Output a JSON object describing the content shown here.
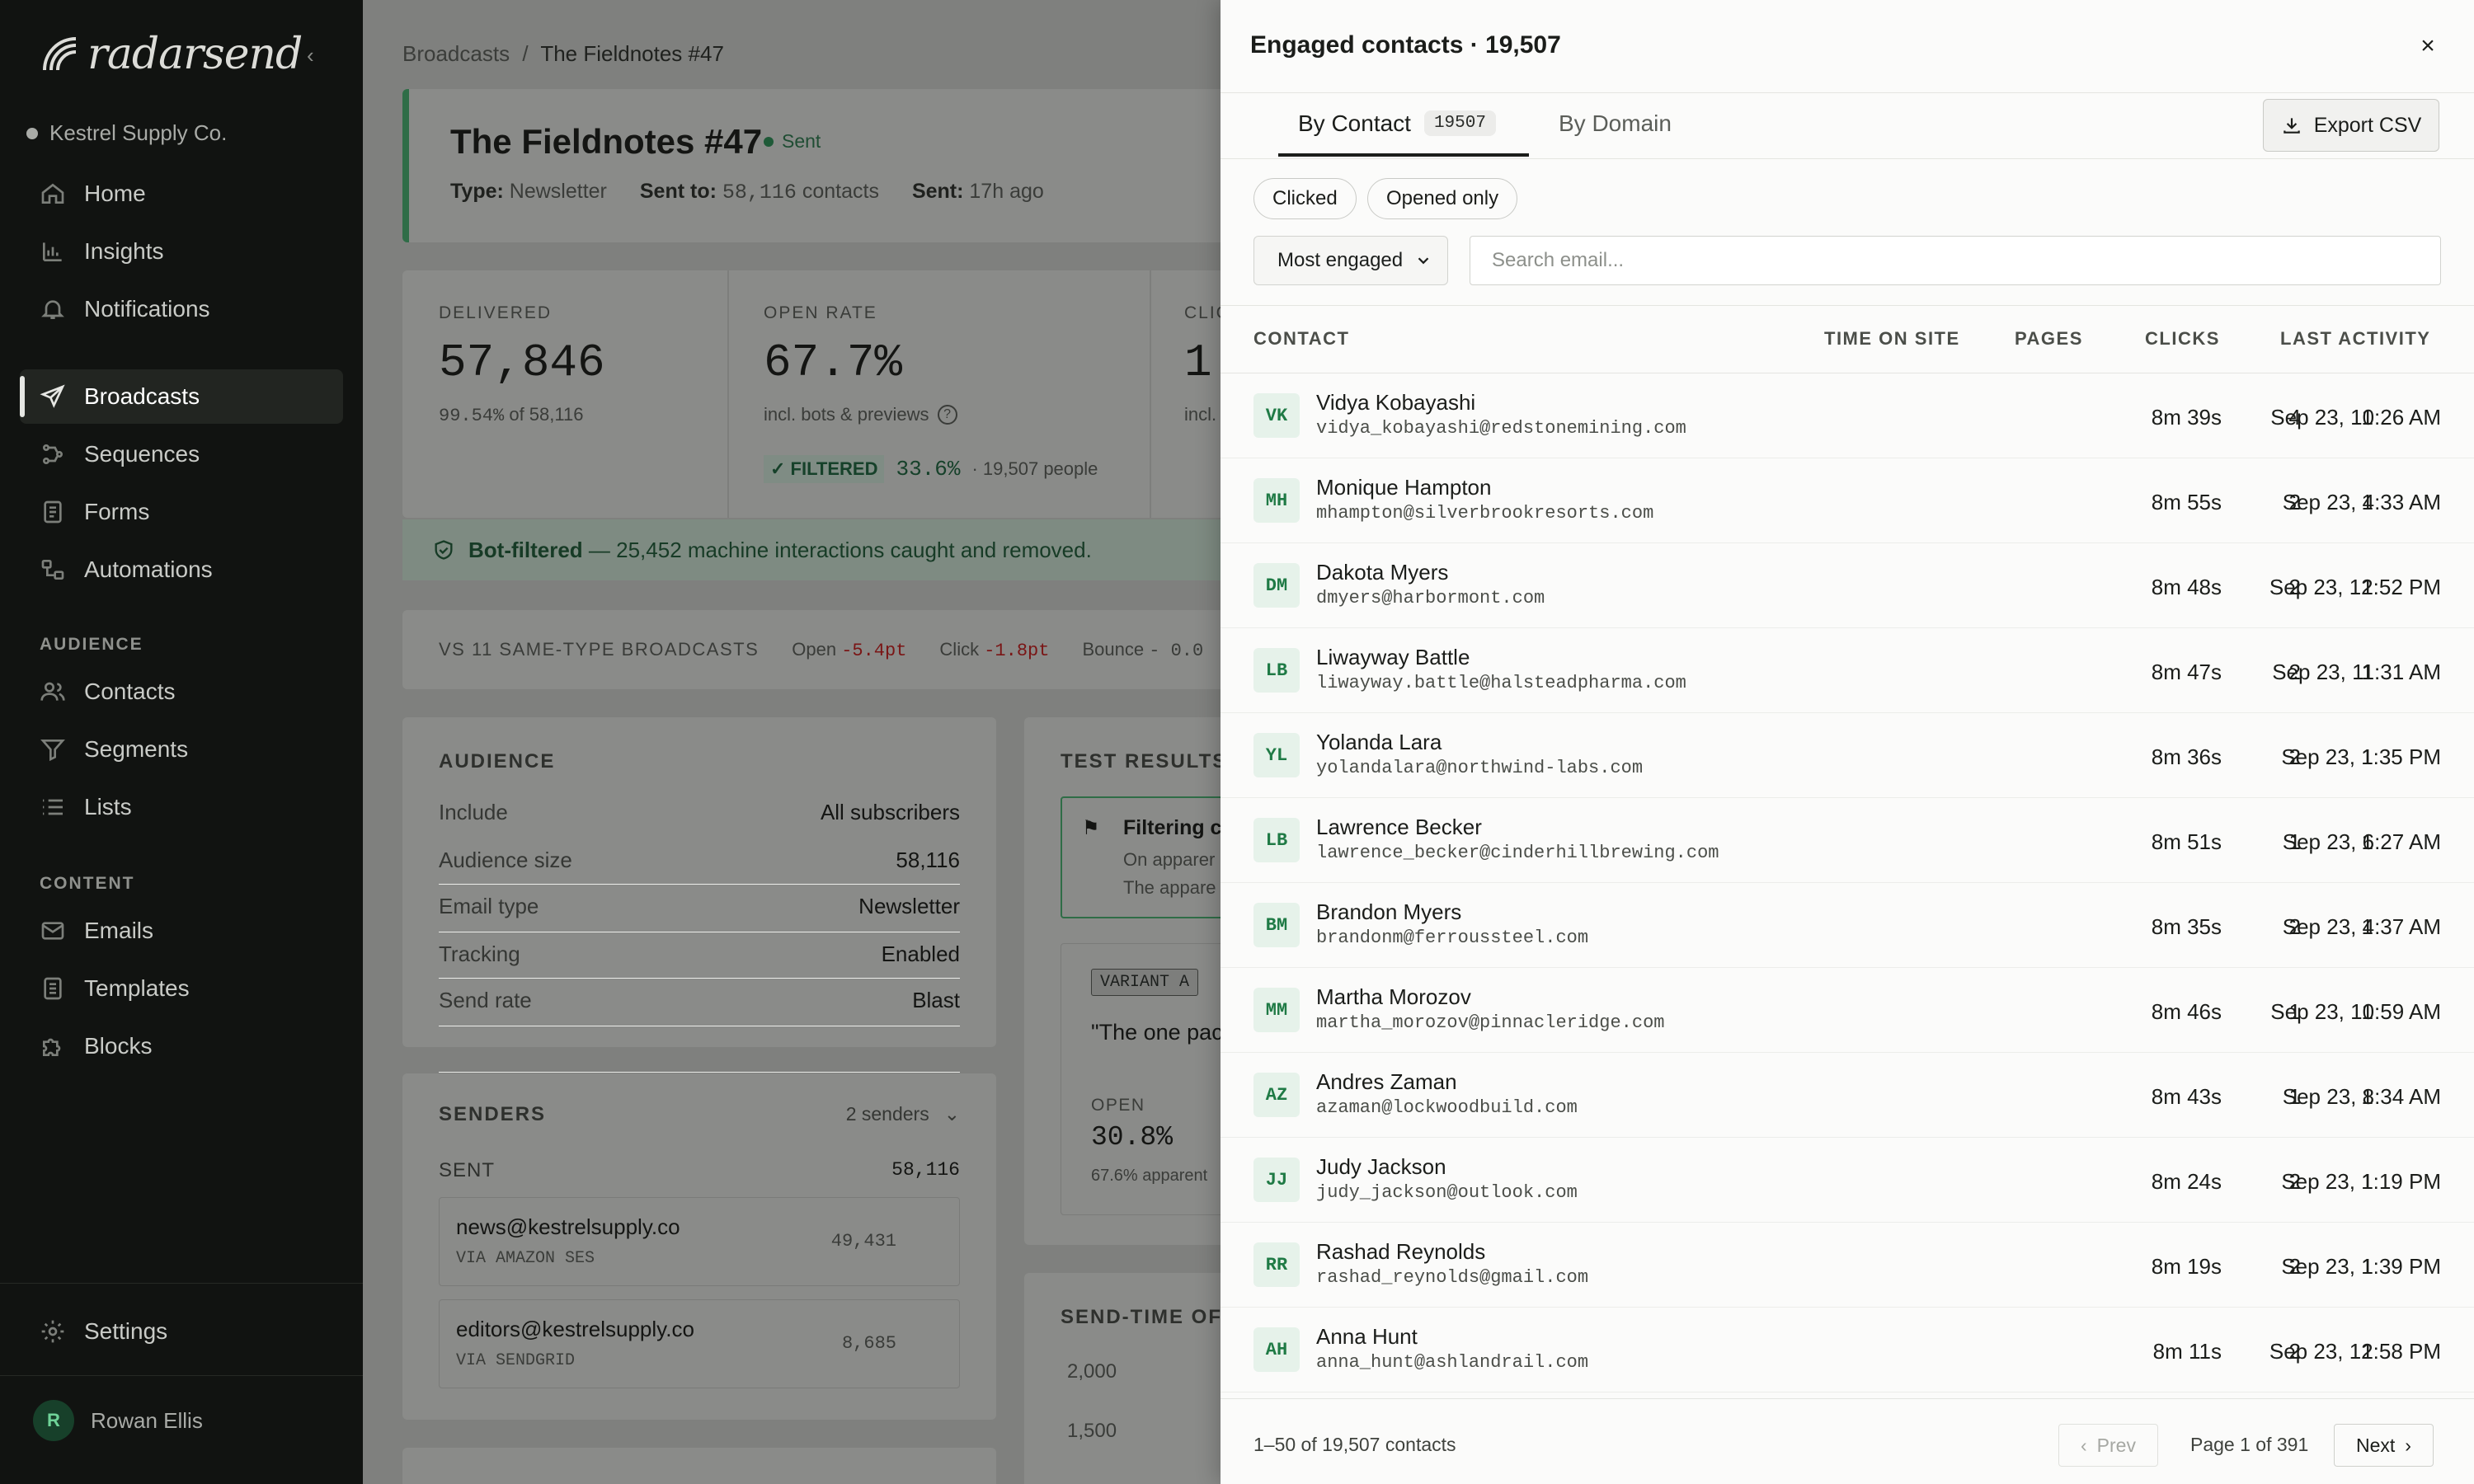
{
  "sidebar": {
    "brand": "radarsend",
    "org": "Kestrel Supply Co.",
    "nav": [
      {
        "label": "Home",
        "icon": "home-icon"
      },
      {
        "label": "Insights",
        "icon": "chart-icon"
      },
      {
        "label": "Notifications",
        "icon": "bell-icon"
      },
      {
        "label": "Broadcasts",
        "icon": "send-icon"
      },
      {
        "label": "Sequences",
        "icon": "sequence-icon"
      },
      {
        "label": "Forms",
        "icon": "form-icon"
      },
      {
        "label": "Automations",
        "icon": "automation-icon"
      }
    ],
    "audience_label": "AUDIENCE",
    "audience": [
      {
        "label": "Contacts",
        "icon": "users-icon"
      },
      {
        "label": "Segments",
        "icon": "filter-icon"
      },
      {
        "label": "Lists",
        "icon": "list-icon"
      }
    ],
    "content_label": "CONTENT",
    "content": [
      {
        "label": "Emails",
        "icon": "mail-icon"
      },
      {
        "label": "Templates",
        "icon": "template-icon"
      },
      {
        "label": "Blocks",
        "icon": "puzzle-icon"
      }
    ],
    "settings": "Settings",
    "user_initial": "R",
    "user_name": "Rowan Ellis"
  },
  "main": {
    "breadcrumb_root": "Broadcasts",
    "breadcrumb_sep": "/",
    "breadcrumb_current": "The Fieldnotes #47",
    "title": "The Fieldnotes #47",
    "status": "Sent",
    "type_label": "Type:",
    "type_value": "Newsletter",
    "sent_to_label": "Sent to:",
    "sent_to_value": "58,116",
    "sent_to_unit": "contacts",
    "sent_label": "Sent:",
    "sent_value": "17h ago",
    "delivered_label": "DELIVERED",
    "delivered_value": "57,846",
    "delivered_pct": "99.54%",
    "delivered_of": "of 58,116",
    "open_label": "OPEN RATE",
    "open_value": "67.7%",
    "open_note": "incl. bots & previews",
    "filtered_badge": "✓ FILTERED",
    "filtered_value": "33.6%",
    "filtered_people": "· 19,507 people",
    "click_label": "CLIC",
    "click_value": "1:",
    "click_note": "incl.",
    "bot_title": "Bot-filtered",
    "bot_text": "— 25,452 machine interactions caught and removed.",
    "vs_label": "VS 11 SAME-TYPE BROADCASTS",
    "vs_open_label": "Open",
    "vs_open": "-5.4pt",
    "vs_click_label": "Click",
    "vs_click": "-1.8pt",
    "vs_bounce_label": "Bounce",
    "vs_bounce": "- 0.0",
    "audience_title": "AUDIENCE",
    "audience_rows": [
      {
        "k": "Include",
        "v": "All subscribers"
      },
      {
        "k": "Audience size",
        "v": "58,116"
      },
      {
        "k": "Email type",
        "v": "Newsletter"
      },
      {
        "k": "Tracking",
        "v": "Enabled"
      },
      {
        "k": "Send rate",
        "v": "Blast"
      }
    ],
    "senders_title": "SENDERS",
    "senders_count": "2 senders",
    "sent_title": "SENT",
    "sent_total": "58,116",
    "senders": [
      {
        "email": "news@kestrelsupply.co",
        "via": "VIA AMAZON SES",
        "count": "49,431"
      },
      {
        "email": "editors@kestrelsupply.co",
        "via": "VIA SENDGRID",
        "count": "8,685"
      }
    ],
    "test_title": "TEST RESULTS",
    "test_filter_title": "Filtering ch",
    "test_filter_l1": "On apparer",
    "test_filter_l2": "The appare",
    "variant_badge": "VARIANT A",
    "variant_quote": "\"The one pac",
    "variant_open_label": "OPEN",
    "variant_open": "30.8%",
    "variant_apparent": "67.6% apparent",
    "send_time_title": "SEND-TIME OF D",
    "send_time_y1": "2,000",
    "send_time_y2": "1,500"
  },
  "drawer": {
    "title": "Engaged contacts · 19,507",
    "close": "×",
    "tab_contact": "By Contact",
    "tab_contact_count": "19507",
    "tab_domain": "By Domain",
    "export": "Export CSV",
    "filter_clicked": "Clicked",
    "filter_opened": "Opened only",
    "sort_value": "Most engaged",
    "search_placeholder": "Search email...",
    "col_contact": "CONTACT",
    "col_time": "TIME ON SITE",
    "col_pages": "PAGES",
    "col_clicks": "CLICKS",
    "col_last": "LAST ACTIVITY",
    "rows": [
      {
        "initials": "VK",
        "name": "Vidya Kobayashi",
        "email": "vidya_kobayashi@redstonemining.com",
        "time": "8m 39s",
        "pages": "4",
        "clicks": "1",
        "last": "Sep 23, 10:26 AM"
      },
      {
        "initials": "MH",
        "name": "Monique Hampton",
        "email": "mhampton@silverbrookresorts.com",
        "time": "8m 55s",
        "pages": "2",
        "clicks": "1",
        "last": "Sep 23, 4:33 AM"
      },
      {
        "initials": "DM",
        "name": "Dakota Myers",
        "email": "dmyers@harbormont.com",
        "time": "8m 48s",
        "pages": "2",
        "clicks": "1",
        "last": "Sep 23, 12:52 PM"
      },
      {
        "initials": "LB",
        "name": "Liwayway Battle",
        "email": "liwayway.battle@halsteadpharma.com",
        "time": "8m 47s",
        "pages": "2",
        "clicks": "1",
        "last": "Sep 23, 11:31 AM"
      },
      {
        "initials": "YL",
        "name": "Yolanda Lara",
        "email": "yolandalara@northwind-labs.com",
        "time": "8m 36s",
        "pages": "2",
        "clicks": "1",
        "last": "Sep 23, 1:35 PM"
      },
      {
        "initials": "LB",
        "name": "Lawrence Becker",
        "email": "lawrence_becker@cinderhillbrewing.com",
        "time": "8m 51s",
        "pages": "1",
        "clicks": "1",
        "last": "Sep 23, 6:27 AM"
      },
      {
        "initials": "BM",
        "name": "Brandon Myers",
        "email": "brandonm@ferroussteel.com",
        "time": "8m 35s",
        "pages": "2",
        "clicks": "1",
        "last": "Sep 23, 4:37 AM"
      },
      {
        "initials": "MM",
        "name": "Martha Morozov",
        "email": "martha_morozov@pinnacleridge.com",
        "time": "8m 46s",
        "pages": "1",
        "clicks": "1",
        "last": "Sep 23, 10:59 AM"
      },
      {
        "initials": "AZ",
        "name": "Andres Zaman",
        "email": "azaman@lockwoodbuild.com",
        "time": "8m 43s",
        "pages": "1",
        "clicks": "1",
        "last": "Sep 23, 8:34 AM"
      },
      {
        "initials": "JJ",
        "name": "Judy Jackson",
        "email": "judy_jackson@outlook.com",
        "time": "8m 24s",
        "pages": "2",
        "clicks": "1",
        "last": "Sep 23, 1:19 PM"
      },
      {
        "initials": "RR",
        "name": "Rashad Reynolds",
        "email": "rashad_reynolds@gmail.com",
        "time": "8m 19s",
        "pages": "2",
        "clicks": "1",
        "last": "Sep 23, 1:39 PM"
      },
      {
        "initials": "AH",
        "name": "Anna Hunt",
        "email": "anna_hunt@ashlandrail.com",
        "time": "8m 11s",
        "pages": "2",
        "clicks": "1",
        "last": "Sep 23, 12:58 PM"
      }
    ],
    "footer_info": "1–50 of 19,507 contacts",
    "prev": "Prev",
    "page_info": "Page 1 of 391",
    "next": "Next"
  }
}
